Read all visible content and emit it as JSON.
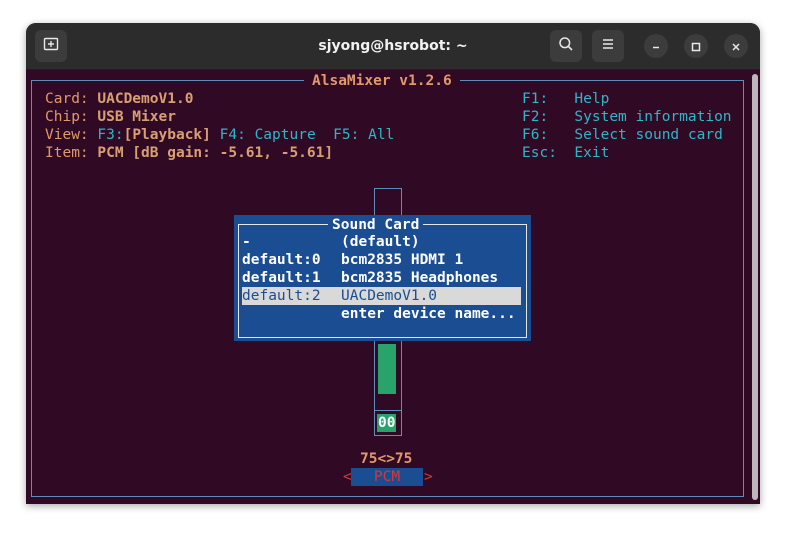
{
  "window": {
    "title": "sjyong@hsrobot: ~"
  },
  "icons": {
    "new_tab": "new-tab-icon",
    "search": "search-icon",
    "menu": "hamburger-menu-icon",
    "minimize": "minimize-icon",
    "maximize": "maximize-icon",
    "close": "close-icon"
  },
  "colors": {
    "terminal_bg": "#300a24",
    "label": "#e09a6a",
    "accent_cyan": "#2fb5c6",
    "dialog_bg": "#1a4d92",
    "meter_green": "#2aa36b",
    "frame": "#5f8fb8"
  },
  "alsamixer": {
    "title": "AlsaMixer v1.2.6",
    "info": {
      "card_label": "Card:",
      "card_value": "UACDemoV1.0",
      "chip_label": "Chip:",
      "chip_value": "USB Mixer",
      "view_label": "View:",
      "view_f3": "F3:",
      "view_playback": "[Playback]",
      "view_f4": "F4:",
      "view_capture": "Capture",
      "view_f5": "F5:",
      "view_all": "All",
      "item_label": "Item:",
      "item_value": "PCM [dB gain: -5.61, -5.61]"
    },
    "keys": [
      {
        "key": "F1:",
        "desc": "Help"
      },
      {
        "key": "F2:",
        "desc": "System information"
      },
      {
        "key": "F6:",
        "desc": "Select sound card"
      },
      {
        "key": "Esc:",
        "desc": "Exit"
      }
    ],
    "control": {
      "level_text": "00",
      "volume_text": "75<>75",
      "name": "PCM",
      "left_arrow": "<",
      "right_arrow": ">"
    }
  },
  "sound_card_dialog": {
    "title": "Sound Card",
    "items": [
      {
        "id": "-",
        "name": "(default)"
      },
      {
        "id": "default:0",
        "name": "bcm2835 HDMI 1"
      },
      {
        "id": "default:1",
        "name": "bcm2835 Headphones"
      },
      {
        "id": "default:2",
        "name": "UACDemoV1.0"
      },
      {
        "id": "",
        "name": "enter device name..."
      }
    ],
    "selected_index": 3
  }
}
